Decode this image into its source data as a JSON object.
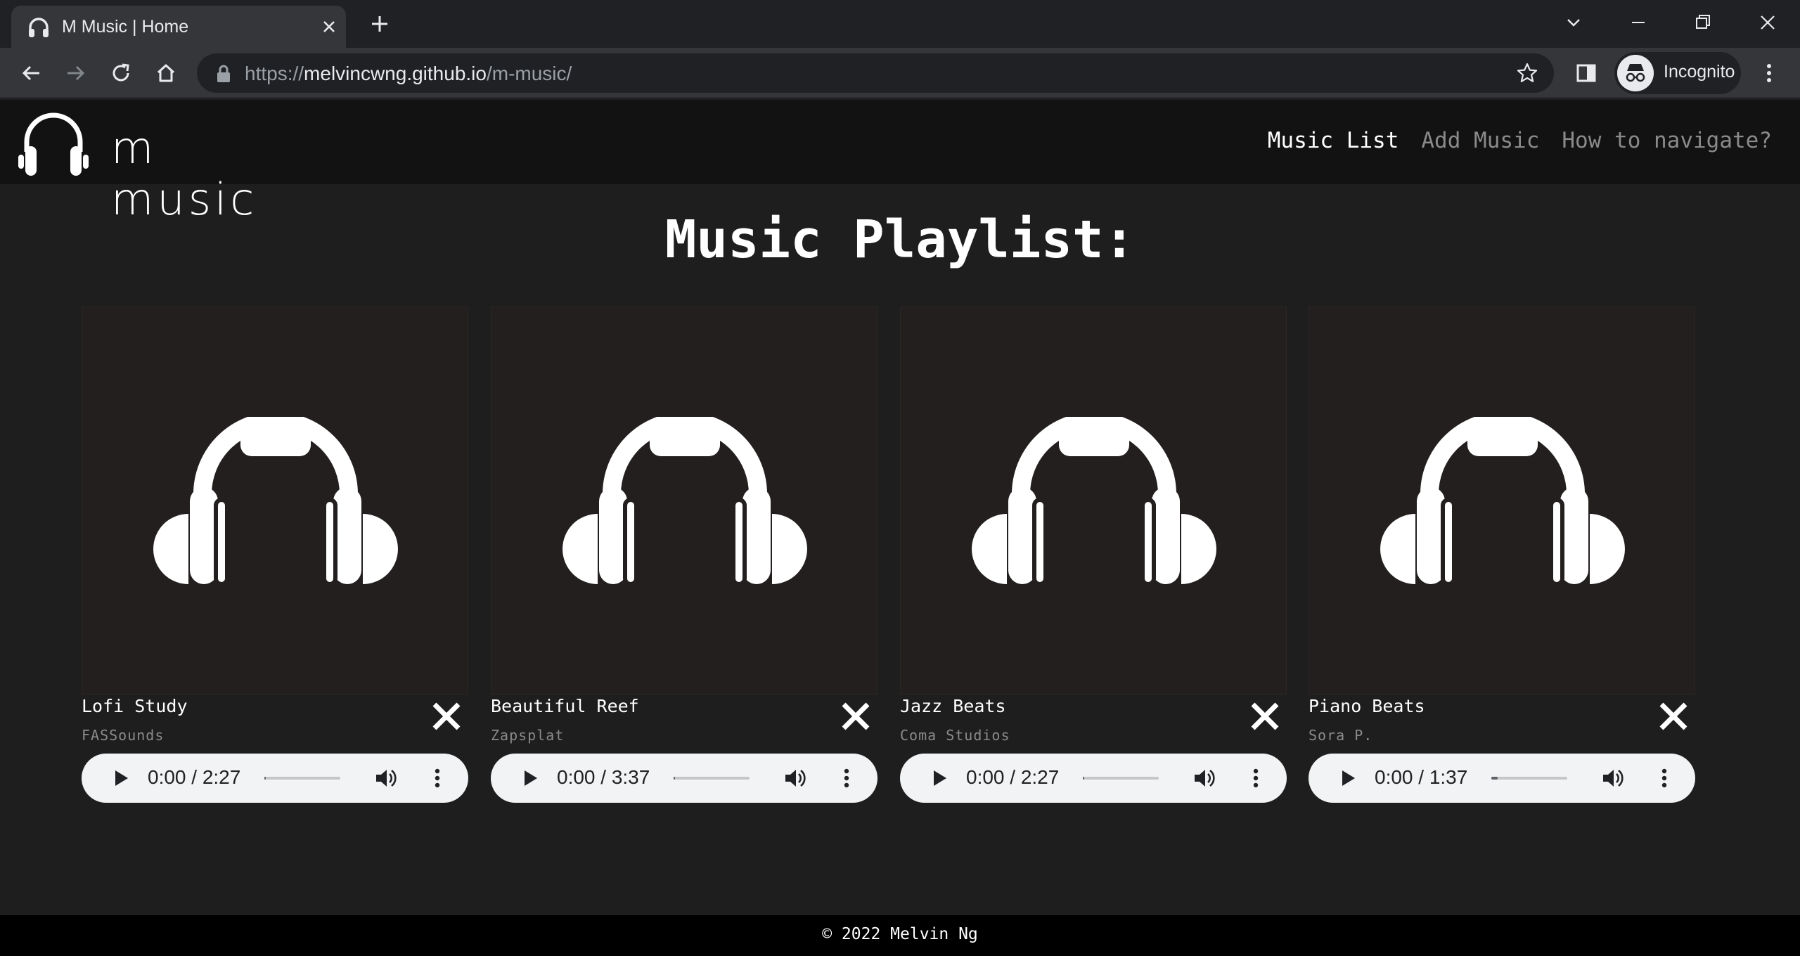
{
  "browser": {
    "tab_title": "M Music | Home",
    "url_prefix": "https://",
    "url_host": "melvincwng.github.io",
    "url_path": "/m-music/",
    "profile_label": "Incognito"
  },
  "header": {
    "logo_text": "m music",
    "nav": [
      "Music List",
      "Add Music",
      "How to navigate?"
    ],
    "active_nav": "Music List"
  },
  "main": {
    "title": "Music Playlist:",
    "tracks": [
      {
        "title": "Lofi Study",
        "artist": "FASSounds",
        "time": "0:00 / 2:27",
        "progress": 0
      },
      {
        "title": "Beautiful Reef",
        "artist": "Zapsplat",
        "time": "0:00 / 3:37",
        "progress": 0
      },
      {
        "title": "Jazz Beats",
        "artist": "Coma Studios",
        "time": "0:00 / 2:27",
        "progress": 0
      },
      {
        "title": "Piano Beats",
        "artist": "Sora P.",
        "time": "0:00 / 1:37",
        "progress": 0.08
      }
    ]
  },
  "footer": {
    "copyright": "© 2022 Melvin Ng"
  },
  "colors": {
    "page_bg": "#1e1e1e",
    "header_bg": "#121212",
    "cover_bg": "#231f1e",
    "player_bg": "#f1f3f4",
    "footer_bg": "#000000"
  }
}
